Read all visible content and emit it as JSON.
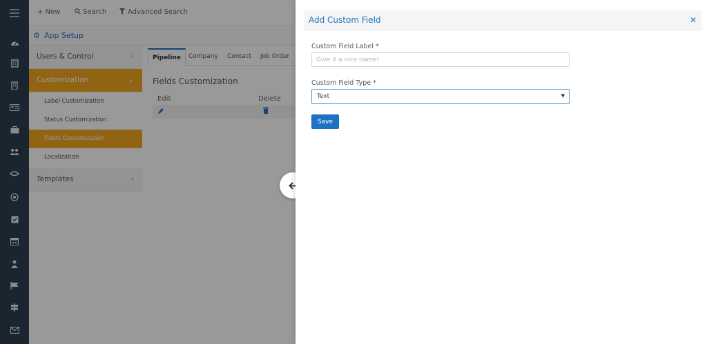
{
  "topbar": {
    "new_label": "+ New",
    "search_label": "Search",
    "advanced_search_label": "Advanced Search"
  },
  "app_setup": {
    "title": "App Setup"
  },
  "sidebar": {
    "items": [
      {
        "label": "Users & Control"
      },
      {
        "label": "Customization"
      },
      {
        "label": "Label Customization"
      },
      {
        "label": "Status Customization"
      },
      {
        "label": "Fields Customization"
      },
      {
        "label": "Localization"
      },
      {
        "label": "Templates"
      }
    ]
  },
  "main": {
    "tabs": [
      "Pipeline",
      "Company",
      "Contact",
      "Job Order"
    ],
    "section_title": "Fields Customization",
    "columns": [
      "Edit",
      "Delete"
    ]
  },
  "drawer": {
    "title": "Add Custom Field",
    "label_field_label": "Custom Field Label *",
    "label_placeholder": "Give it a nice name!",
    "type_field_label": "Custom Field Type *",
    "type_value": "Text",
    "save_label": "Save"
  },
  "colors": {
    "accent": "#1e72c4",
    "active_menu": "#f2a720",
    "rail": "#2c3e50"
  },
  "icons": [
    "menu-icon",
    "dashboard-icon",
    "pipeline-icon",
    "company-icon",
    "contact-card-icon",
    "briefcase-icon",
    "users-icon",
    "handshake-icon",
    "target-icon",
    "checklist-icon",
    "calendar-icon",
    "person-icon",
    "flag-icon",
    "signpost-icon",
    "mail-icon",
    "gear-icon",
    "pencil-icon",
    "trash-icon",
    "arrow-left-icon",
    "close-icon"
  ]
}
